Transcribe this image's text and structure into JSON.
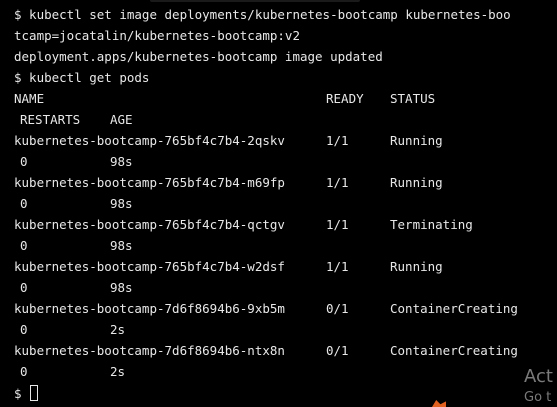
{
  "terminal": {
    "cmd1_line1": "$ kubectl set image deployments/kubernetes-bootcamp kubernetes-boo",
    "cmd1_line2": "tcamp=jocatalin/kubernetes-bootcamp:v2",
    "cmd1_output": "deployment.apps/kubernetes-bootcamp image updated",
    "cmd2": "$ kubectl get pods",
    "headers": {
      "name": "NAME",
      "ready": "READY",
      "status": "STATUS",
      "restarts": "RESTARTS",
      "age": "AGE"
    },
    "pods": [
      {
        "name": "kubernetes-bootcamp-765bf4c7b4-2qskv",
        "ready": "1/1",
        "status": "Running",
        "restarts": "0",
        "age": "98s"
      },
      {
        "name": "kubernetes-bootcamp-765bf4c7b4-m69fp",
        "ready": "1/1",
        "status": "Running",
        "restarts": "0",
        "age": "98s"
      },
      {
        "name": "kubernetes-bootcamp-765bf4c7b4-qctgv",
        "ready": "1/1",
        "status": "Terminating",
        "restarts": "0",
        "age": "98s"
      },
      {
        "name": "kubernetes-bootcamp-765bf4c7b4-w2dsf",
        "ready": "1/1",
        "status": "Running",
        "restarts": "0",
        "age": "98s"
      },
      {
        "name": "kubernetes-bootcamp-7d6f8694b6-9xb5m",
        "ready": "0/1",
        "status": "ContainerCreating",
        "restarts": "0",
        "age": "2s"
      },
      {
        "name": "kubernetes-bootcamp-7d6f8694b6-ntx8n",
        "ready": "0/1",
        "status": "ContainerCreating",
        "restarts": "0",
        "age": "2s"
      }
    ],
    "prompt": "$"
  },
  "watermark": {
    "line1": "Act",
    "line2": "Go t"
  },
  "colors": {
    "background": "#000000",
    "text": "#e8e8e8",
    "watermark": "#7a7a7a"
  }
}
